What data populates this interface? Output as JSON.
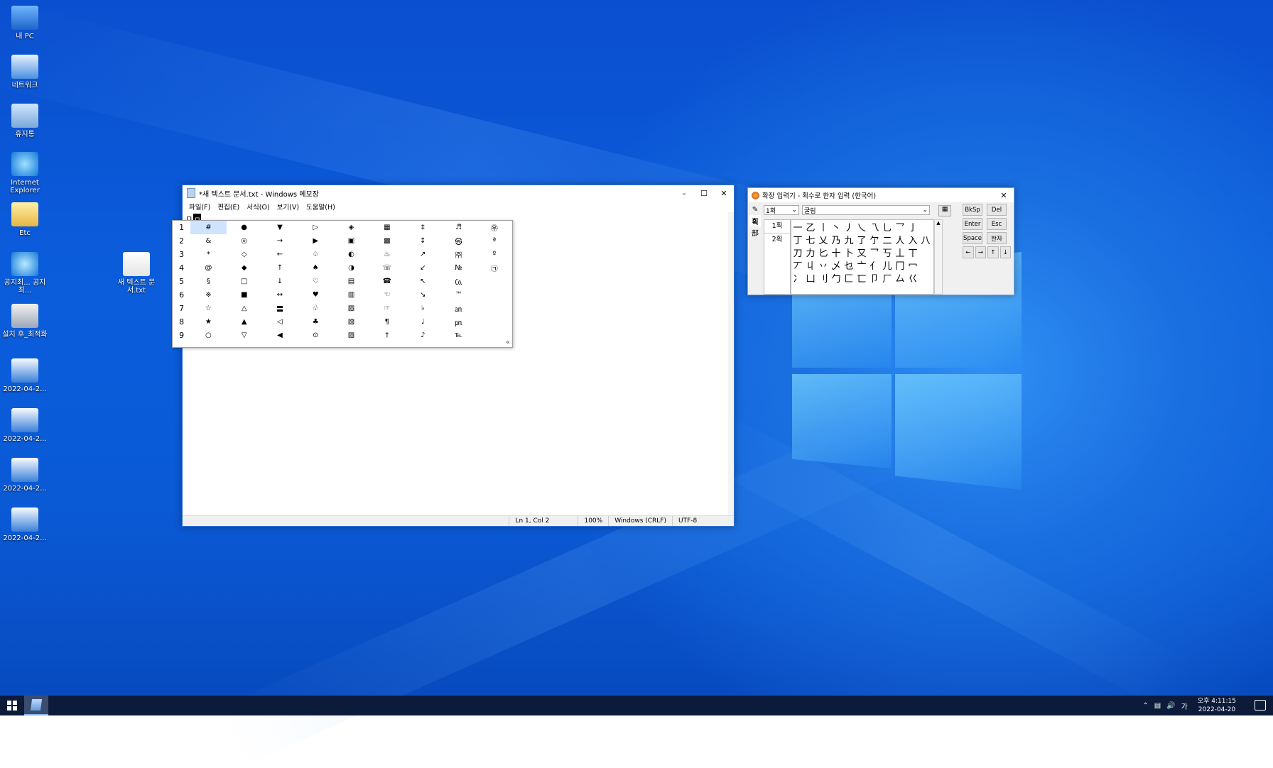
{
  "desktop": {
    "icons": [
      {
        "label": "내 PC",
        "icon": "computer-icon"
      },
      {
        "label": "네트워크",
        "icon": "network-icon"
      },
      {
        "label": "휴지통",
        "icon": "recycle-bin-icon"
      },
      {
        "label": "Internet Explorer",
        "icon": "internet-explorer-icon"
      },
      {
        "label": "Etc",
        "icon": "folder-icon"
      },
      {
        "label": "공지최... 공지최...",
        "icon": "ie-shortcut-icon"
      },
      {
        "label": "설치 후_최적화",
        "icon": "settings-shortcut-icon"
      },
      {
        "label": "2022-04-2...",
        "icon": "screenshot-file-icon"
      },
      {
        "label": "2022-04-2...",
        "icon": "screenshot-file-icon"
      },
      {
        "label": "2022-04-2...",
        "icon": "screenshot-file-icon"
      },
      {
        "label": "2022-04-2...",
        "icon": "screenshot-file-icon"
      },
      {
        "label": "새 텍스트 문서.txt",
        "icon": "text-file-icon"
      }
    ]
  },
  "notepad": {
    "title": "*새 텍스트 문서.txt - Windows 메모장",
    "menu": [
      "파일(F)",
      "편집(E)",
      "서식(O)",
      "보기(V)",
      "도움말(H)"
    ],
    "line_text": "ㅁ",
    "ime_candidate_key": "ㅁ",
    "symbol_rows": [
      {
        "n": "1",
        "s": [
          "#",
          "●",
          "▼",
          "▷",
          "◈",
          "▦",
          "‡",
          "♬",
          "㉾"
        ]
      },
      {
        "n": "2",
        "s": [
          "&",
          "◎",
          "→",
          "▶",
          "▣",
          "▩",
          "↕",
          "㉿",
          "ª"
        ]
      },
      {
        "n": "3",
        "s": [
          "*",
          "◇",
          "←",
          "♤",
          "◐",
          "♨",
          "↗",
          "㈜",
          "º"
        ]
      },
      {
        "n": "4",
        "s": [
          "@",
          "◆",
          "↑",
          "♠",
          "◑",
          "☏",
          "↙",
          "№",
          "㉠"
        ]
      },
      {
        "n": "5",
        "s": [
          "§",
          "□",
          "↓",
          "♡",
          "▤",
          "☎",
          "↖",
          "㏇",
          ""
        ]
      },
      {
        "n": "6",
        "s": [
          "※",
          "■",
          "↔",
          "♥",
          "▥",
          "☜",
          "↘",
          "™",
          ""
        ]
      },
      {
        "n": "7",
        "s": [
          "☆",
          "△",
          "〓",
          "♧",
          "▨",
          "☞",
          "♭",
          "㏂",
          ""
        ]
      },
      {
        "n": "8",
        "s": [
          "★",
          "▲",
          "◁",
          "♣",
          "▧",
          "¶",
          "♩",
          "㏘",
          ""
        ]
      },
      {
        "n": "9",
        "s": [
          "○",
          "▽",
          "◀",
          "⊙",
          "▧",
          "†",
          "♪",
          "℡",
          ""
        ]
      }
    ],
    "expand_glyph": "«",
    "status": {
      "pos": "Ln 1, Col 2",
      "zoom": "100%",
      "eol": "Windows (CRLF)",
      "enc": "UTF-8"
    }
  },
  "ime_pad": {
    "title": "확장 입력기 - 획수로 한자 입력 (한국어)",
    "stroke_select": "1획",
    "font_select": "굴림",
    "side_tabs": [
      "획",
      "部"
    ],
    "stroke_labels": [
      "1획",
      "2획"
    ],
    "chars": [
      "一",
      "乙",
      "丨",
      "丶",
      "丿",
      "乀",
      "乁",
      "乚",
      "乛",
      "亅",
      "",
      "丁",
      "七",
      "乂",
      "乃",
      "九",
      "了",
      "亇",
      "二",
      "人",
      "入",
      "八",
      "刀",
      "力",
      "匕",
      "十",
      "卜",
      "又",
      "乛",
      "丂",
      "丄",
      "丅",
      "",
      "丆",
      "丩",
      "丷",
      "乄",
      "乜",
      "亠",
      "亻",
      "儿",
      "冂",
      "冖",
      "",
      "冫",
      "凵",
      "刂",
      "勹",
      "匚",
      "匸",
      "卩",
      "厂",
      "厶",
      "巜",
      ""
    ],
    "keys": [
      "BkSp",
      "Del",
      "Enter",
      "Esc",
      "Space",
      "한자"
    ],
    "arrows": [
      "←",
      "→",
      "↑",
      "↓"
    ]
  },
  "taskbar": {
    "clock_time": "오후 4:11:15",
    "clock_date": "2022-04-20",
    "ime_indicator": "가"
  }
}
